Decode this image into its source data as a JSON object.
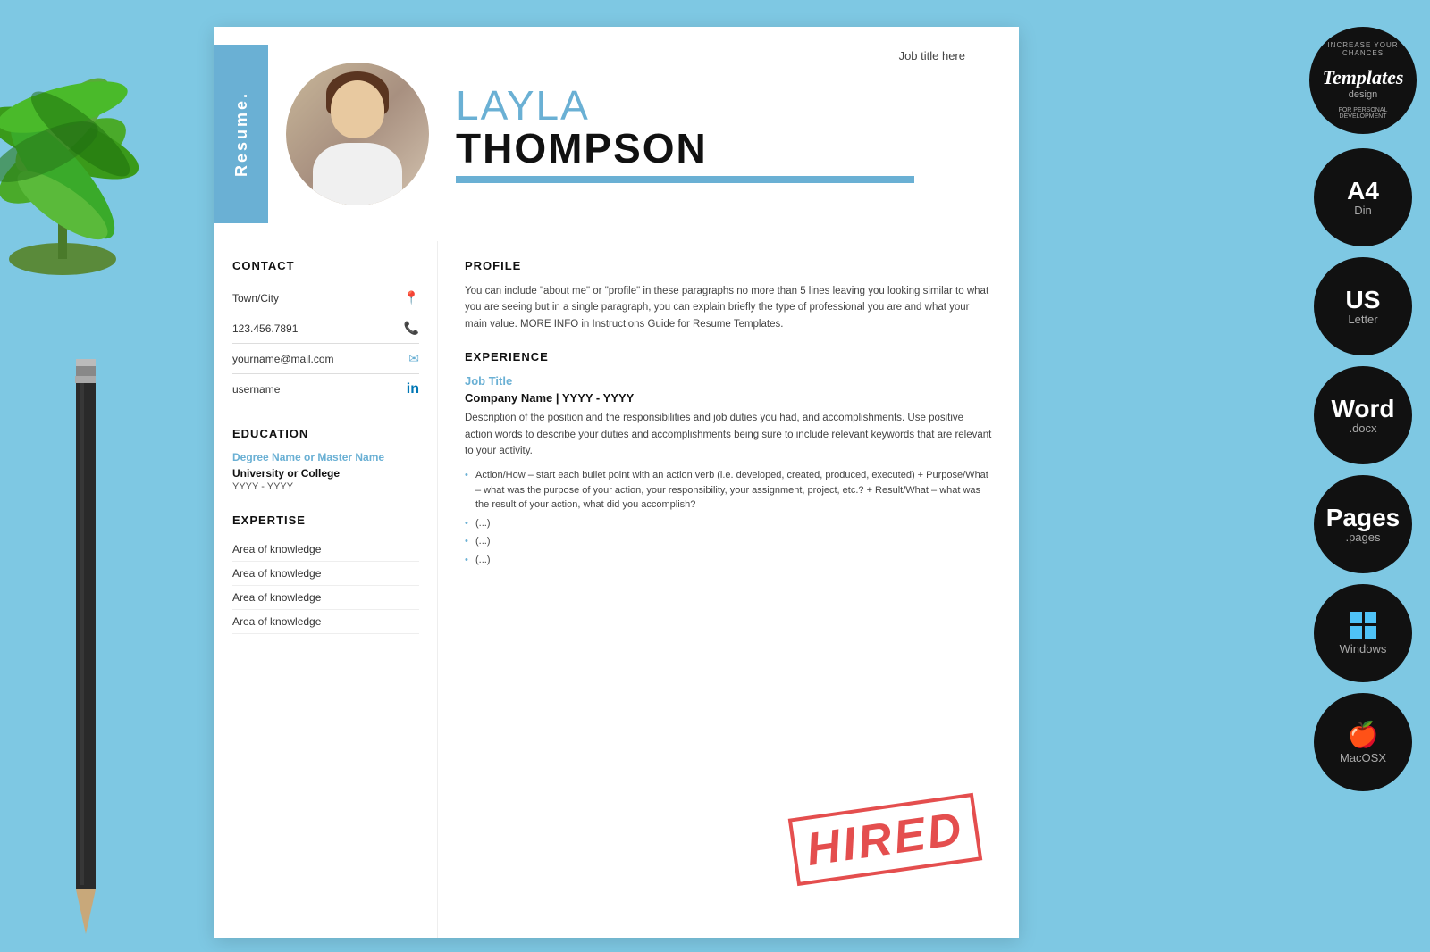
{
  "background_color": "#7ec8e3",
  "resume": {
    "sidebar_text": "Resume.",
    "header": {
      "job_title_placeholder": "Job title here",
      "first_name": "LAYLA",
      "last_name": "THOMPSON"
    },
    "contact": {
      "section_title": "CONTACT",
      "town": "Town/City",
      "phone": "123.456.7891",
      "email": "yourname@mail.com",
      "username": "username"
    },
    "education": {
      "section_title": "EDUCATION",
      "degree": "Degree Name or Master Name",
      "university": "University or College",
      "years": "YYYY - YYYY"
    },
    "expertise": {
      "section_title": "EXPERTISE",
      "items": [
        "Area of knowledge",
        "Area of knowledge",
        "Area of knowledge",
        "Area of knowledge"
      ]
    },
    "profile": {
      "section_title": "PROFILE",
      "text": "You can include \"about me\" or \"profile\" in these paragraphs no more than 5 lines leaving you looking similar to what you are seeing but in a single paragraph, you can explain briefly the type of professional you are and what your main value. MORE INFO in Instructions Guide for Resume Templates."
    },
    "experience": {
      "section_title": "EXPERIENCE",
      "job_title": "Job Title",
      "company_line": "Company Name | YYYY - YYYY",
      "description": "Description of the position and the responsibilities and job duties you had, and accomplishments. Use positive action words to describe your duties and accomplishments being sure to include relevant keywords that are relevant to your activity.",
      "bullets": [
        "Action/How – start each bullet point with an action verb (i.e. developed, created, produced, executed) + Purpose/What – what was the purpose of your action, your responsibility, your assignment, project, etc.? + Result/What – what was the result of your action, what did you accomplish?",
        "(...)",
        "(...)",
        "(...)"
      ]
    },
    "hired_stamp": "HIRED"
  },
  "right_sidebar": {
    "logo": {
      "circle_text": "INCREASE YOUR CHANCES",
      "main": "Templates",
      "sub": "design",
      "tagline": "FOR PERSONAL DEVELOPMENT"
    },
    "options": [
      {
        "main": "A4",
        "sub": "Din"
      },
      {
        "main": "US",
        "sub": "Letter"
      },
      {
        "main": "Word",
        "sub": ".docx"
      },
      {
        "main": "Pages",
        "sub": ".pages"
      },
      {
        "main": "Windows",
        "sub": ""
      },
      {
        "main": "",
        "sub": "MacOSX"
      }
    ]
  }
}
